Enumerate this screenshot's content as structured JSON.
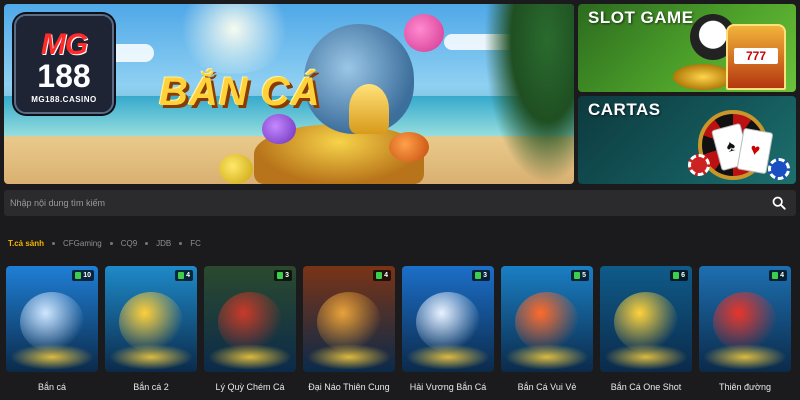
{
  "hero": {
    "title": "BẮN CÁ",
    "logo": {
      "brand": "MG",
      "number": "188",
      "domain": "MG188.CASINO"
    }
  },
  "side_banners": [
    {
      "label": "SLOT GAME",
      "reels": "777"
    },
    {
      "label": "CARTAS"
    }
  ],
  "search": {
    "placeholder": "Nhập nội dung tìm kiếm",
    "icon": "search-icon"
  },
  "filters": [
    {
      "label": "T.cả sảnh",
      "active": true
    },
    {
      "label": "CFGaming",
      "active": false
    },
    {
      "label": "CQ9",
      "active": false
    },
    {
      "label": "JDB",
      "active": false
    },
    {
      "label": "FC",
      "active": false
    }
  ],
  "games": [
    {
      "name": "Bắn cá",
      "count": "10",
      "bg": "#1f7fd6",
      "accent": "#cfe6ff"
    },
    {
      "name": "Bắn cá 2",
      "count": "4",
      "bg": "#1e8ac9",
      "accent": "#ffcf3a"
    },
    {
      "name": "Lý Quỳ Chém Cá",
      "count": "3",
      "bg": "#2b4a2e",
      "accent": "#c93a2a"
    },
    {
      "name": "Đại Náo Thiên Cung",
      "count": "4",
      "bg": "#7a3416",
      "accent": "#e8a23a"
    },
    {
      "name": "Hải Vương Bắn Cá",
      "count": "3",
      "bg": "#1c6fc9",
      "accent": "#e9f2ff"
    },
    {
      "name": "Bắn Cá Vui Vẻ",
      "count": "5",
      "bg": "#1a7fc4",
      "accent": "#ff6a2a"
    },
    {
      "name": "Bắn Cá One Shot",
      "count": "6",
      "bg": "#0f5b8a",
      "accent": "#ffd23a"
    },
    {
      "name": "Thiên đường",
      "count": "4",
      "bg": "#1d6fb0",
      "accent": "#e8352a"
    }
  ],
  "colors": {
    "page_bg": "#1b1b1d",
    "active_filter": "#f5b400",
    "badge_icon": "#3ccf4e"
  }
}
